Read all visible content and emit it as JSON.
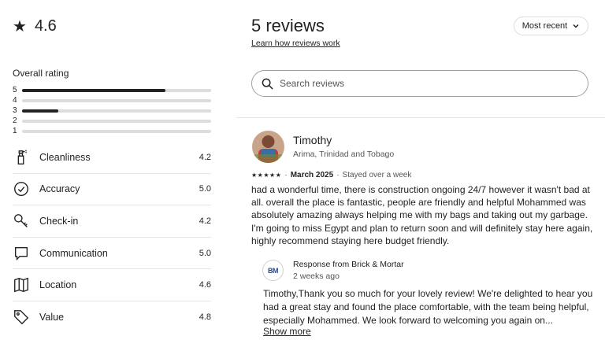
{
  "summary": {
    "star_icon": "star-icon",
    "rating": "4.6",
    "overall_label": "Overall rating",
    "distribution": [
      {
        "stars": "5",
        "fraction": 0.76
      },
      {
        "stars": "4",
        "fraction": 0.0
      },
      {
        "stars": "3",
        "fraction": 0.19
      },
      {
        "stars": "2",
        "fraction": 0.0
      },
      {
        "stars": "1",
        "fraction": 0.0
      }
    ]
  },
  "categories": [
    {
      "label": "Cleanliness",
      "score": "4.2",
      "icon": "spray-bottle-icon"
    },
    {
      "label": "Accuracy",
      "score": "5.0",
      "icon": "check-circle-icon"
    },
    {
      "label": "Check-in",
      "score": "4.2",
      "icon": "key-icon"
    },
    {
      "label": "Communication",
      "score": "5.0",
      "icon": "chat-bubble-icon"
    },
    {
      "label": "Location",
      "score": "4.6",
      "icon": "map-icon"
    },
    {
      "label": "Value",
      "score": "4.8",
      "icon": "price-tag-icon"
    }
  ],
  "header": {
    "title": "5 reviews",
    "learn_link": "Learn how reviews work",
    "sort_label": "Most recent"
  },
  "search": {
    "placeholder": "Search reviews"
  },
  "review": {
    "name": "Timothy",
    "location": "Arima, Trinidad and Tobago",
    "stars": "★★★★★",
    "separator": "·",
    "date": "March 2025",
    "stay": "Stayed over a week",
    "text": "had a wonderful time, there is construction ongoing 24/7 however it wasn't bad at all. overall the place is fantastic, people are friendly and helpful Mohammed was absolutely amazing always helping me with my bags and taking out my garbage. I'm going to miss Egypt and plan to return soon and will definitely stay here again,  highly recommend staying here budget friendly.",
    "response": {
      "logo_text": "BM",
      "from": "Response from Brick & Mortar",
      "when": "2 weeks ago",
      "text": "Timothy,Thank you so much for your lovely review! We're delighted to hear you had a great stay and found the place comfortable, with the team being helpful, especially Mohammed. We look forward to welcoming you again on...",
      "show_more": "Show more"
    }
  }
}
